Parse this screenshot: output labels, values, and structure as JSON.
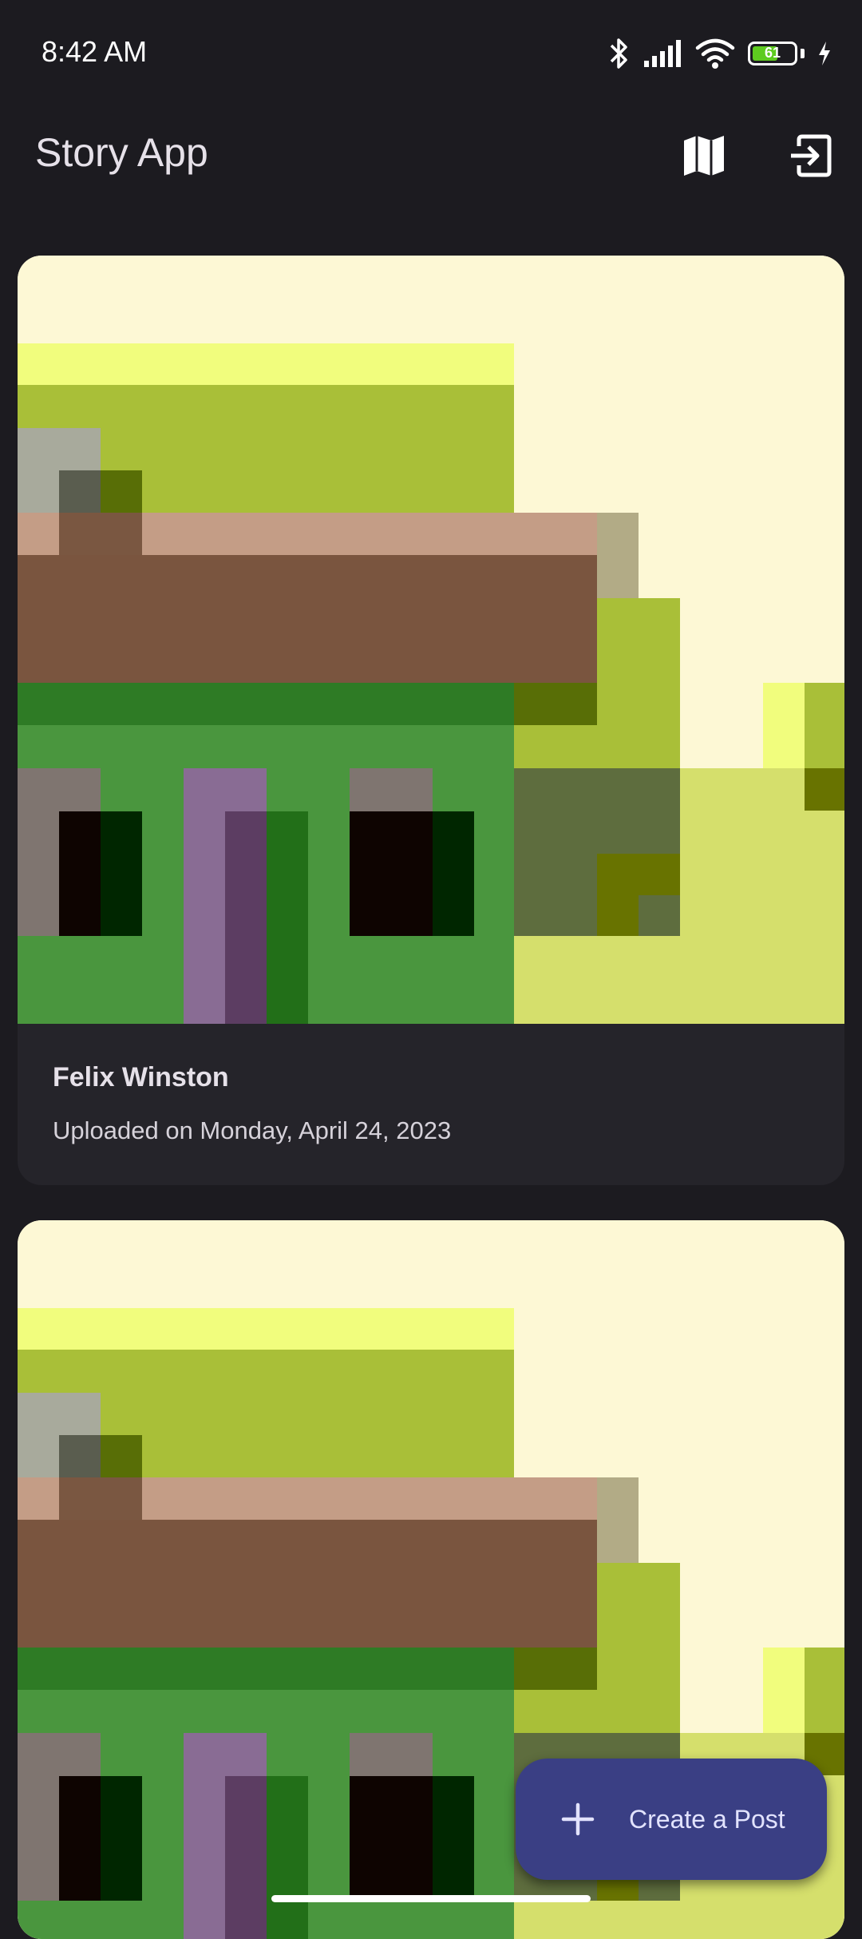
{
  "status_bar": {
    "time": "8:42 AM",
    "battery_level": "61",
    "battery_fraction": 0.61,
    "icons": [
      "bluetooth-icon",
      "signal-icon",
      "wifi-icon",
      "battery-icon",
      "charging-icon"
    ]
  },
  "app_bar": {
    "title": "Story App",
    "actions": [
      "map-icon",
      "logout-icon"
    ]
  },
  "stories": [
    {
      "name": "Felix Winston",
      "date": "Uploaded on Monday, April 24, 2023"
    },
    {
      "name": "",
      "date": ""
    }
  ],
  "fab": {
    "label": "Create a Post",
    "icon": "plus-icon"
  },
  "colors": {
    "background": "#1c1b20",
    "card": "#25242a",
    "fab": "#3a3f84",
    "text": "#e6e1e9"
  }
}
